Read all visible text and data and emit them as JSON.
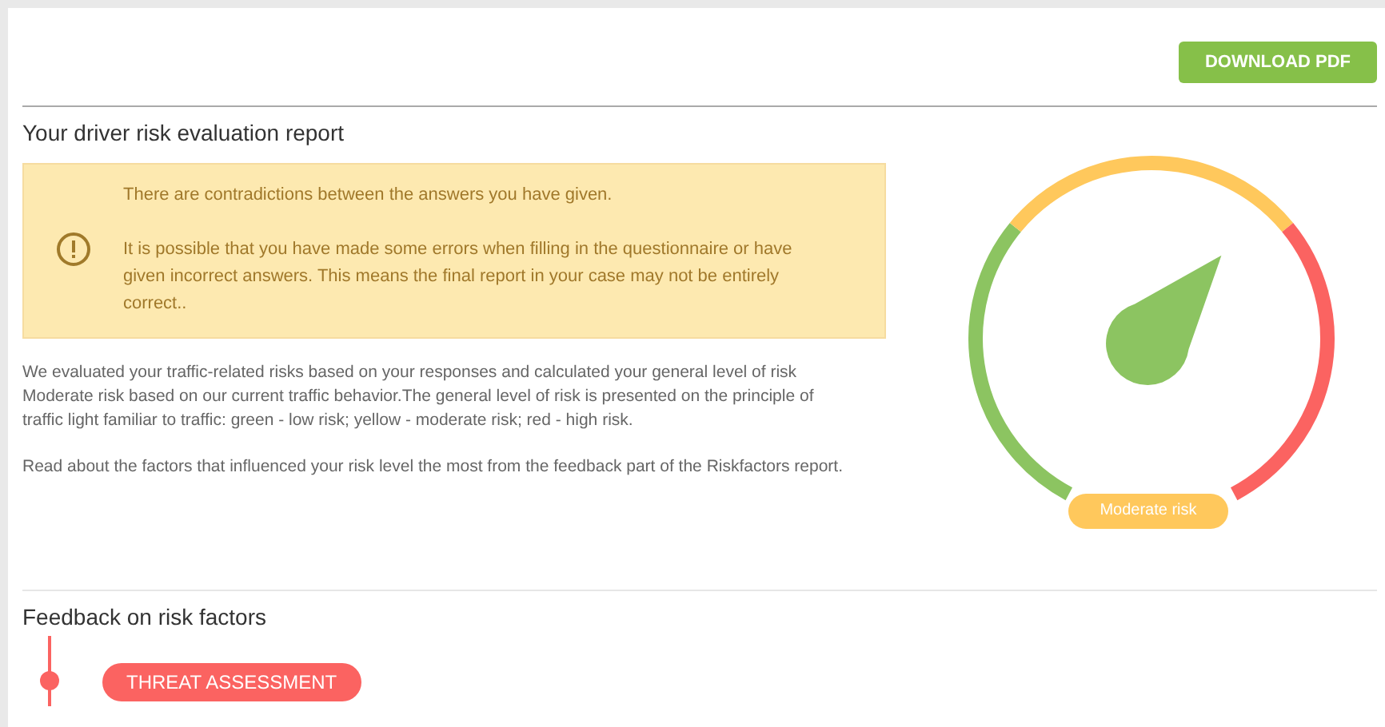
{
  "toolbar": {
    "download_button": "DOWNLOAD PDF"
  },
  "report": {
    "title": "Your driver risk evaluation report",
    "warning": {
      "heading": "There are contradictions between the answers you have given.",
      "body": "It is possible that you have made some errors when filling in the questionnaire or have given incorrect answers. This means the final report in your case may not be entirely correct.."
    },
    "paragraphs": [
      "We evaluated your traffic-related risks based on your responses and calculated your general level of risk Moderate risk based on our current traffic behavior.The general level of risk is presented on the principle of traffic light familiar to traffic: green - low risk; yellow - moderate risk; red - high risk.",
      "Read about the factors that influenced your risk level the most from the feedback part of the Riskfactors report."
    ],
    "gauge": {
      "label": "Moderate risk",
      "segments": [
        {
          "color": "#8cc461"
        },
        {
          "color": "#ffc85c"
        },
        {
          "color": "#fb6361"
        }
      ]
    }
  },
  "feedback": {
    "title": "Feedback on risk factors",
    "items": [
      {
        "label": "THREAT ASSESSMENT"
      }
    ]
  }
}
